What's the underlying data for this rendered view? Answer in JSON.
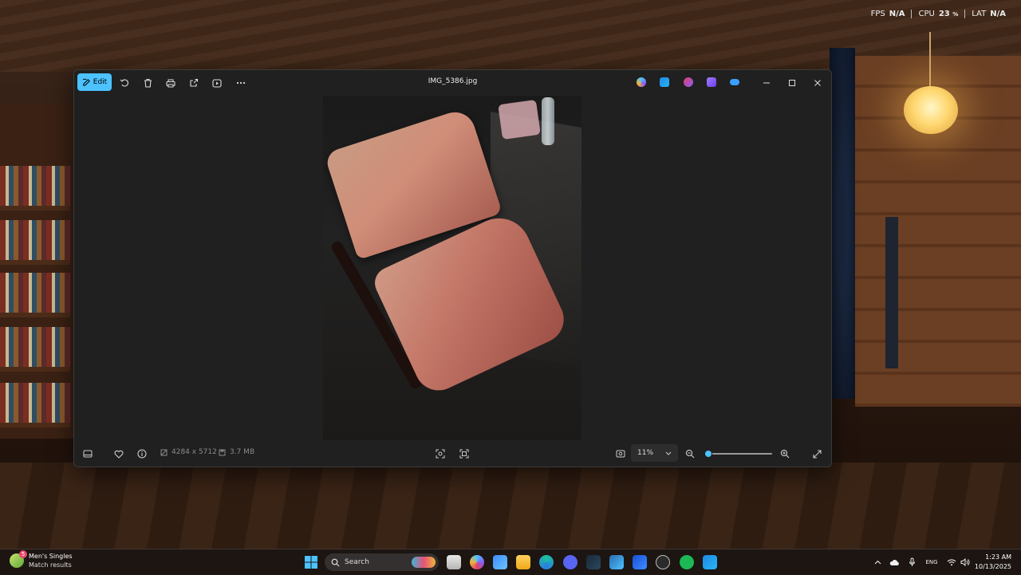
{
  "perf": {
    "fps_label": "FPS",
    "fps_value": "N/A",
    "cpu_label": "CPU",
    "cpu_value": "23",
    "cpu_unit": "%",
    "lat_label": "LAT",
    "lat_value": "N/A"
  },
  "photos": {
    "file_title": "IMG_5386.jpg",
    "edit_label": "Edit",
    "toolbar_icons": [
      "edit-icon",
      "rotate-icon",
      "delete-icon",
      "print-icon",
      "share-icon",
      "slideshow-icon",
      "more-icon"
    ],
    "app_icons": [
      {
        "name": "copilot",
        "color": "#5fb3ff"
      },
      {
        "name": "designer",
        "color": "#2aa9ff"
      },
      {
        "name": "clipchamp",
        "color": "#e0406a"
      },
      {
        "name": "clipchamp-purple",
        "color": "#8a5cf6"
      },
      {
        "name": "onedrive",
        "color": "#3aa0ff"
      }
    ],
    "dimensions": "4284 x 5712",
    "file_size": "3.7 MB",
    "zoom": "11%",
    "zoom_level": 0.02
  },
  "taskbar": {
    "widget_title": "Men's Singles",
    "widget_subtitle": "Match results",
    "widget_badge": "5",
    "search_placeholder": "Search",
    "lang": "ENG",
    "time": "1:23 AM",
    "date": "10/13/2025"
  },
  "colors": {
    "accent": "#4cc2ff",
    "window_bg": "#202020"
  }
}
